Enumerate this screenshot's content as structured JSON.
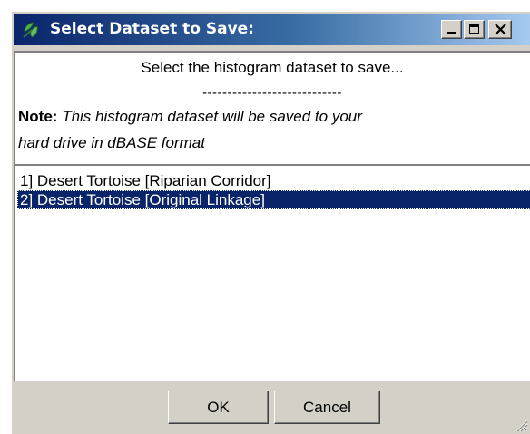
{
  "window": {
    "title": "Select Dataset to Save:",
    "icon": "app-leaf-icon"
  },
  "titlebar_buttons": {
    "minimize_icon": "minimize-icon",
    "maximize_icon": "maximize-icon",
    "close_icon": "close-icon"
  },
  "note_panel": {
    "prompt": "Select the histogram dataset to save...",
    "separator": "----------------------------",
    "note_label": "Note:",
    "note_text_line1": "This histogram dataset will be saved to your",
    "note_text_line2": "hard drive in dBASE format"
  },
  "dataset_list": {
    "items": [
      {
        "label": "1] Desert Tortoise [Riparian Corridor]",
        "selected": false
      },
      {
        "label": "2] Desert Tortoise [Original Linkage]",
        "selected": true
      }
    ]
  },
  "buttons": {
    "ok_label": "OK",
    "cancel_label": "Cancel"
  },
  "colors": {
    "titlebar_start": "#0a246a",
    "titlebar_end": "#a6caf0",
    "selection": "#0a246a",
    "face": "#d4d0c8"
  }
}
